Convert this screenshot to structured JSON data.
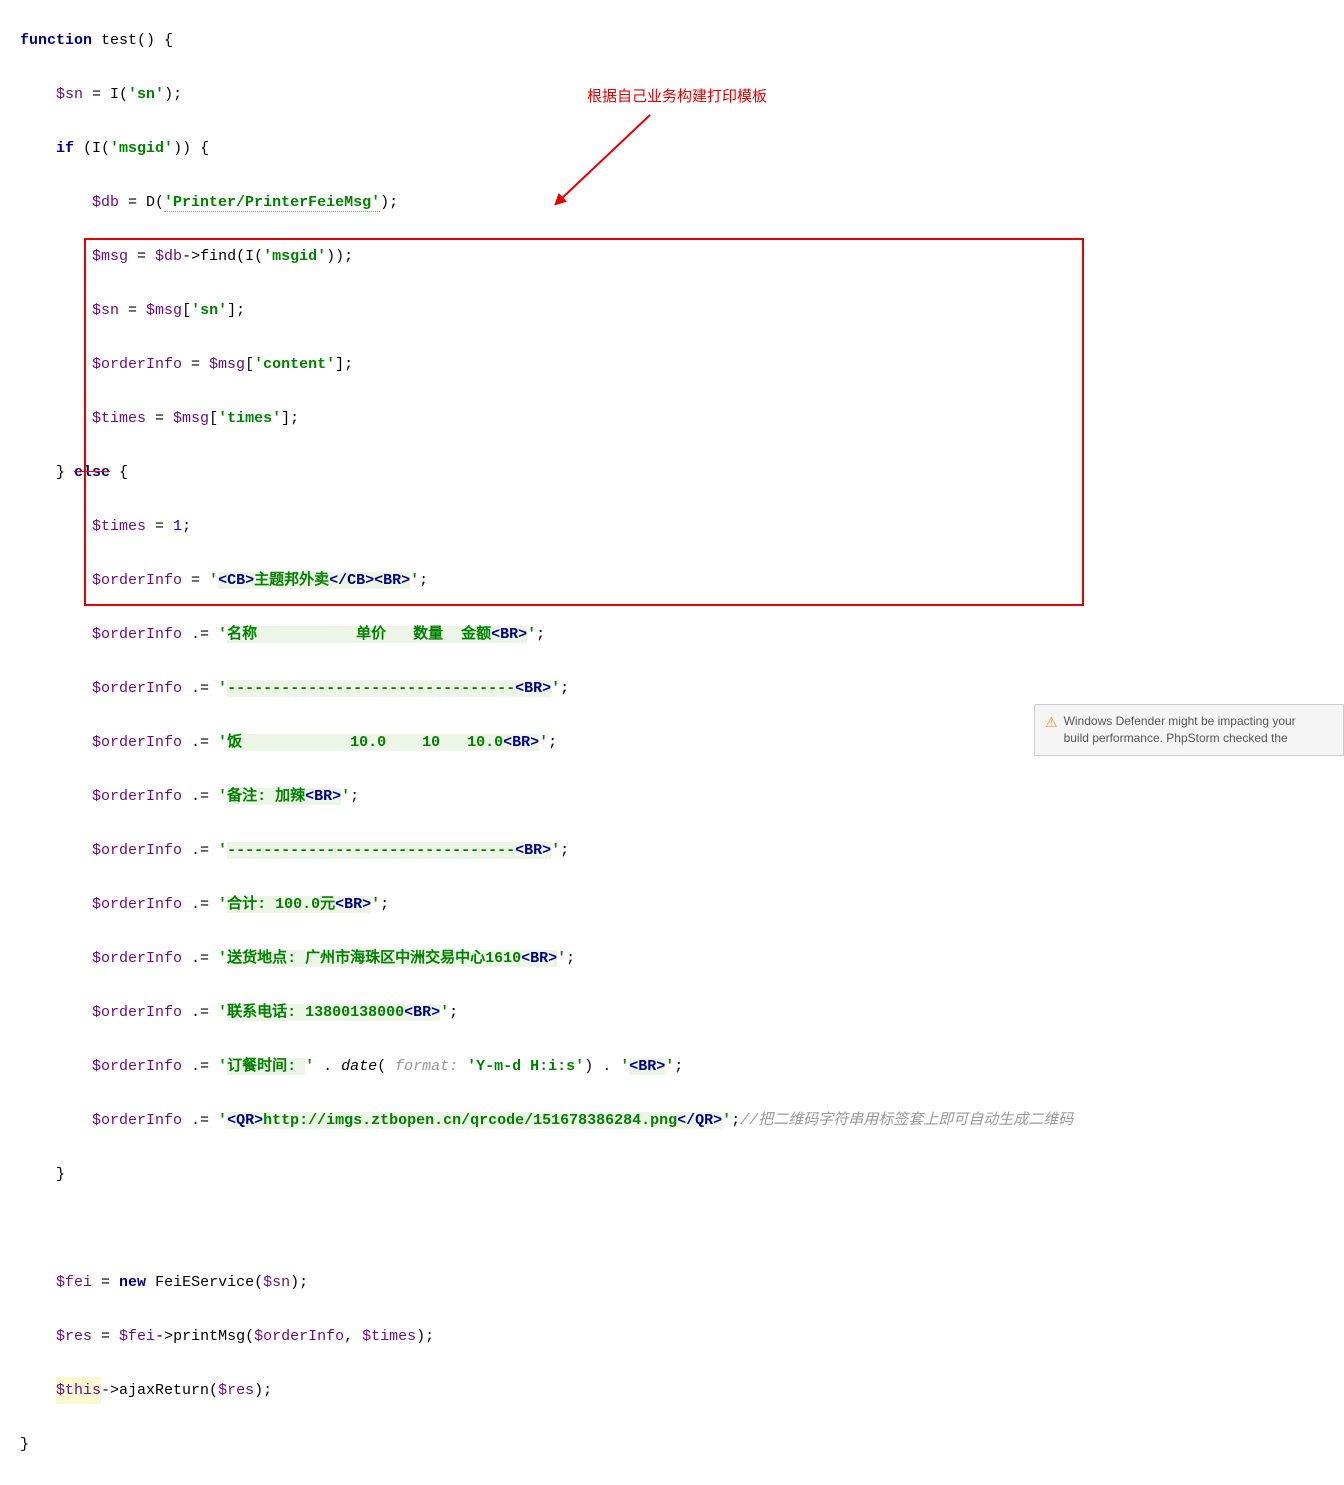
{
  "code": {
    "l1_fn": "function",
    "l1_name": " test() {",
    "l2_var": "$sn",
    "l2_rest": " = I(",
    "l2_str": "'sn'",
    "l2_end": ");",
    "l3_if": "if",
    "l3_rest": " (I(",
    "l3_str": "'msgid'",
    "l3_end": ")) {",
    "l4_var": "$db",
    "l4_rest": " = D(",
    "l4_str": "'Printer/PrinterFeieMsg'",
    "l4_end": ");",
    "l5_var": "$msg",
    "l5_eq": " = ",
    "l5_var2": "$db",
    "l5_rest": "->find(I(",
    "l5_str": "'msgid'",
    "l5_end": "));",
    "l6_var": "$sn",
    "l6_eq": " = ",
    "l6_var2": "$msg",
    "l6_rest": "[",
    "l6_str": "'sn'",
    "l6_end": "];",
    "l7_var": "$orderInfo",
    "l7_eq": " = ",
    "l7_var2": "$msg",
    "l7_rest": "[",
    "l7_str": "'content'",
    "l7_end": "];",
    "l8_var": "$times",
    "l8_eq": " = ",
    "l8_var2": "$msg",
    "l8_rest": "[",
    "l8_str": "'times'",
    "l8_end": "];",
    "l9_close": "} ",
    "l9_else": "else",
    "l9_open": " {",
    "l10_var": "$times",
    "l10_rest": " = ",
    "l10_num": "1",
    "l10_end": ";",
    "l11_var": "$orderInfo",
    "l11_eq": " = ",
    "l11_q": "'",
    "l11_t1": "<CB>",
    "l11_txt": "主题邦外卖",
    "l11_t2": "</CB><BR>",
    "l11_q2": "'",
    "l11_end": ";",
    "l12_var": "$orderInfo",
    "l12_eq": " .= ",
    "l12_q": "'",
    "l12_txt": "名称           单价   数量  金额",
    "l12_t": "<BR>",
    "l12_q2": "'",
    "l12_end": ";",
    "l13_var": "$orderInfo",
    "l13_eq": " .= ",
    "l13_q": "'",
    "l13_txt": "--------------------------------",
    "l13_t": "<BR>",
    "l13_q2": "'",
    "l13_end": ";",
    "l14_var": "$orderInfo",
    "l14_eq": " .= ",
    "l14_q": "'",
    "l14_txt": "饭            10.0    10   10.0",
    "l14_t": "<BR>",
    "l14_q2": "'",
    "l14_end": ";",
    "l15_var": "$orderInfo",
    "l15_eq": " .= ",
    "l15_q": "'",
    "l15_txt": "备注: 加辣",
    "l15_t": "<BR>",
    "l15_q2": "'",
    "l15_end": ";",
    "l16_var": "$orderInfo",
    "l16_eq": " .= ",
    "l16_q": "'",
    "l16_txt": "--------------------------------",
    "l16_t": "<BR>",
    "l16_q2": "'",
    "l16_end": ";",
    "l17_var": "$orderInfo",
    "l17_eq": " .= ",
    "l17_q": "'",
    "l17_txt": "合计: 100.0元",
    "l17_t": "<BR>",
    "l17_q2": "'",
    "l17_end": ";",
    "l18_var": "$orderInfo",
    "l18_eq": " .= ",
    "l18_q": "'",
    "l18_txt": "送货地点: 广州市海珠区中洲交易中心1610",
    "l18_t": "<BR>",
    "l18_q2": "'",
    "l18_end": ";",
    "l19_var": "$orderInfo",
    "l19_eq": " .= ",
    "l19_q": "'",
    "l19_txt": "联系电话: 13800138000",
    "l19_t": "<BR>",
    "l19_q2": "'",
    "l19_end": ";",
    "l20_var": "$orderInfo",
    "l20_eq": " .= ",
    "l20_q": "'",
    "l20_txt": "订餐时间: ",
    "l20_q2": "'",
    "l20_dot": " . ",
    "l20_fn": "date",
    "l20_paren": "( ",
    "l20_hint": "format: ",
    "l20_fmt": "'Y-m-d H:i:s'",
    "l20_paren2": ") . ",
    "l20_q3": "'",
    "l20_t": "<BR>",
    "l20_q4": "'",
    "l20_end": ";",
    "l21_var": "$orderInfo",
    "l21_eq": " .= ",
    "l21_q": "'",
    "l21_t1": "<QR>",
    "l21_txt": "http://imgs.ztbopen.cn/qrcode/151678386284.png",
    "l21_t2": "</QR>",
    "l21_q2": "'",
    "l21_end": ";",
    "l21_comment": "//把二维码字符串用标签套上即可自动生成二维码",
    "l22": "}",
    "l24_var": "$fei",
    "l24_eq": " = ",
    "l24_new": "new",
    "l24_cls": " FeiEService(",
    "l24_var2": "$sn",
    "l24_end": ");",
    "l25_var": "$res",
    "l25_eq": " = ",
    "l25_var2": "$fei",
    "l25_rest": "->printMsg(",
    "l25_var3": "$orderInfo",
    "l25_comma": ", ",
    "l25_var4": "$times",
    "l25_end": ");",
    "l26_this": "$this",
    "l26_rest": "->ajaxReturn(",
    "l26_var": "$res",
    "l26_end": ");",
    "l27": "}"
  },
  "annotation": "根据自己业务构建打印模板",
  "notification": {
    "line1": "Windows Defender might be impacting your",
    "line2": "build performance. PhpStorm checked the"
  }
}
